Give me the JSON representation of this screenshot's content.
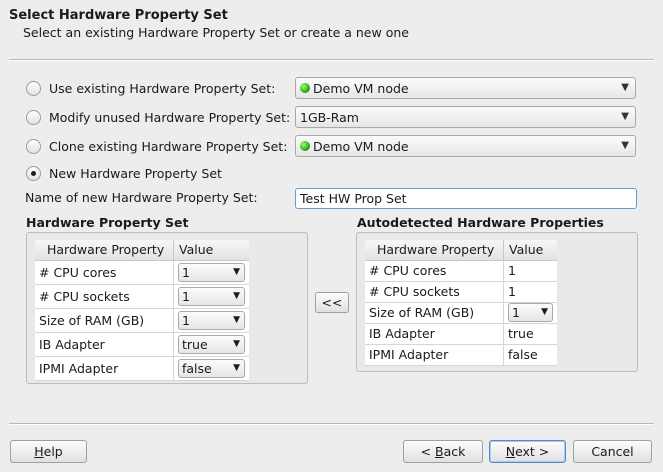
{
  "header": {
    "title": "Select Hardware Property Set",
    "subtitle": "Select an existing Hardware Property Set or create a new one"
  },
  "options": {
    "use_existing": {
      "label": "Use existing Hardware Property Set:",
      "value": "Demo VM node",
      "status_color": "#22aa11"
    },
    "modify_unused": {
      "label": "Modify unused Hardware Property Set:",
      "value": "1GB-Ram"
    },
    "clone_existing": {
      "label": "Clone existing Hardware Property Set:",
      "value": "Demo VM node",
      "status_color": "#22aa11"
    },
    "new_set": {
      "label": "New Hardware Property Set",
      "checked": true
    }
  },
  "name_field": {
    "label": "Name of new Hardware Property Set:",
    "value": "Test HW Prop Set"
  },
  "hw_set": {
    "title": "Hardware Property Set",
    "col_property": "Hardware Property",
    "col_value": "Value",
    "rows": [
      {
        "property": "# CPU cores",
        "value": "1"
      },
      {
        "property": "# CPU sockets",
        "value": "1"
      },
      {
        "property": "Size of RAM (GB)",
        "value": "1"
      },
      {
        "property": "IB Adapter",
        "value": "true"
      },
      {
        "property": "IPMI Adapter",
        "value": "false"
      }
    ]
  },
  "copy_button": {
    "label": "<<"
  },
  "autodetected": {
    "title": "Autodetected Hardware Properties",
    "col_property": "Hardware Property",
    "col_value": "Value",
    "rows": [
      {
        "property": "# CPU cores",
        "value": "1"
      },
      {
        "property": "# CPU sockets",
        "value": "1"
      },
      {
        "property": "Size of RAM (GB)",
        "value": "1"
      },
      {
        "property": "IB Adapter",
        "value": "true"
      },
      {
        "property": "IPMI Adapter",
        "value": "false"
      }
    ]
  },
  "footer": {
    "help": {
      "mnemonic": "H",
      "rest": "elp"
    },
    "back": {
      "prefix": "< ",
      "mnemonic": "B",
      "rest": "ack"
    },
    "next": {
      "mnemonic": "N",
      "rest": "ext >"
    },
    "cancel": "Cancel"
  }
}
